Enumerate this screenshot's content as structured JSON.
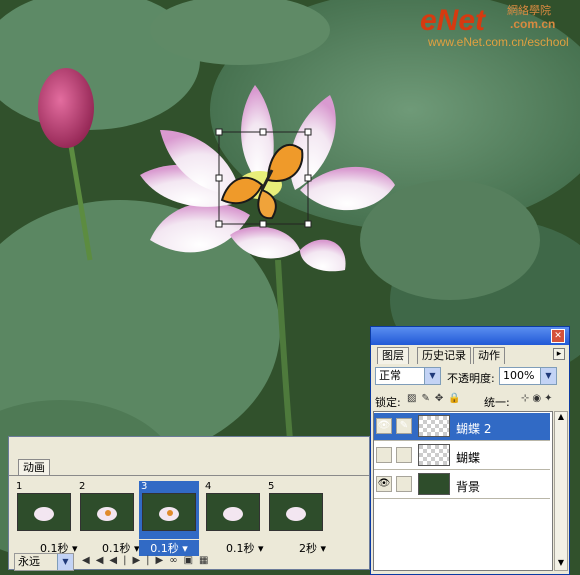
{
  "watermark": {
    "logo": "eNet",
    "site_cn": "網絡學院",
    "site_url": "www.eNet.com.cn/eschool",
    "domain_suffix": ".com.cn"
  },
  "animation_panel": {
    "tab_label": "动画",
    "frames": [
      {
        "number": "1",
        "delay": "0.1秒"
      },
      {
        "number": "2",
        "delay": "0.1秒"
      },
      {
        "number": "3",
        "delay": "0.1秒"
      },
      {
        "number": "4",
        "delay": "0.1秒"
      },
      {
        "number": "5",
        "delay": "2秒"
      }
    ],
    "loop_value": "永远"
  },
  "layers_panel": {
    "tabs": [
      "图层",
      "历史记录",
      "动作"
    ],
    "blend_mode": "正常",
    "opacity_label": "不透明度:",
    "opacity_value": "100%",
    "lock_label": "锁定:",
    "unify_label": "统一:",
    "layers": [
      {
        "name": "蝴蝶 2",
        "visible": true,
        "selected": true
      },
      {
        "name": "蝴蝶",
        "visible": false,
        "selected": false
      },
      {
        "name": "背景",
        "visible": true,
        "selected": false
      }
    ]
  },
  "colors": {
    "selection": "#316ac5",
    "panel_bg": "#ece9d8",
    "close_button": "#d4513a"
  }
}
